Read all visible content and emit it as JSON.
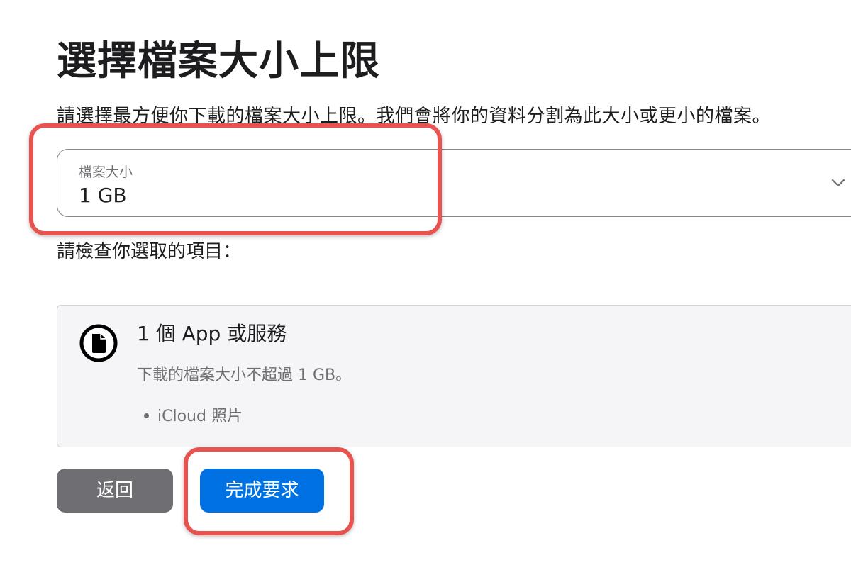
{
  "page": {
    "title": "選擇檔案大小上限",
    "description": "請選擇最方便你下載的檔案大小上限。我們會將你的資料分割為此大小或更小的檔案。"
  },
  "file_size_select": {
    "label": "檔案大小",
    "selected_value": "1 GB",
    "chevron_icon": "chevron-down-icon"
  },
  "review": {
    "label": "請檢查你選取的項目："
  },
  "summary": {
    "icon": "document-icon",
    "title": "1 個 App 或服務",
    "subtitle": "下載的檔案大小不超過 1 GB。",
    "items": [
      "iCloud 照片"
    ]
  },
  "actions": {
    "back_label": "返回",
    "submit_label": "完成要求"
  },
  "colors": {
    "primary_button": "#0071e3",
    "secondary_button": "#6e6e73",
    "highlight_annotation": "#e8524f",
    "card_background": "#f5f5f7"
  }
}
